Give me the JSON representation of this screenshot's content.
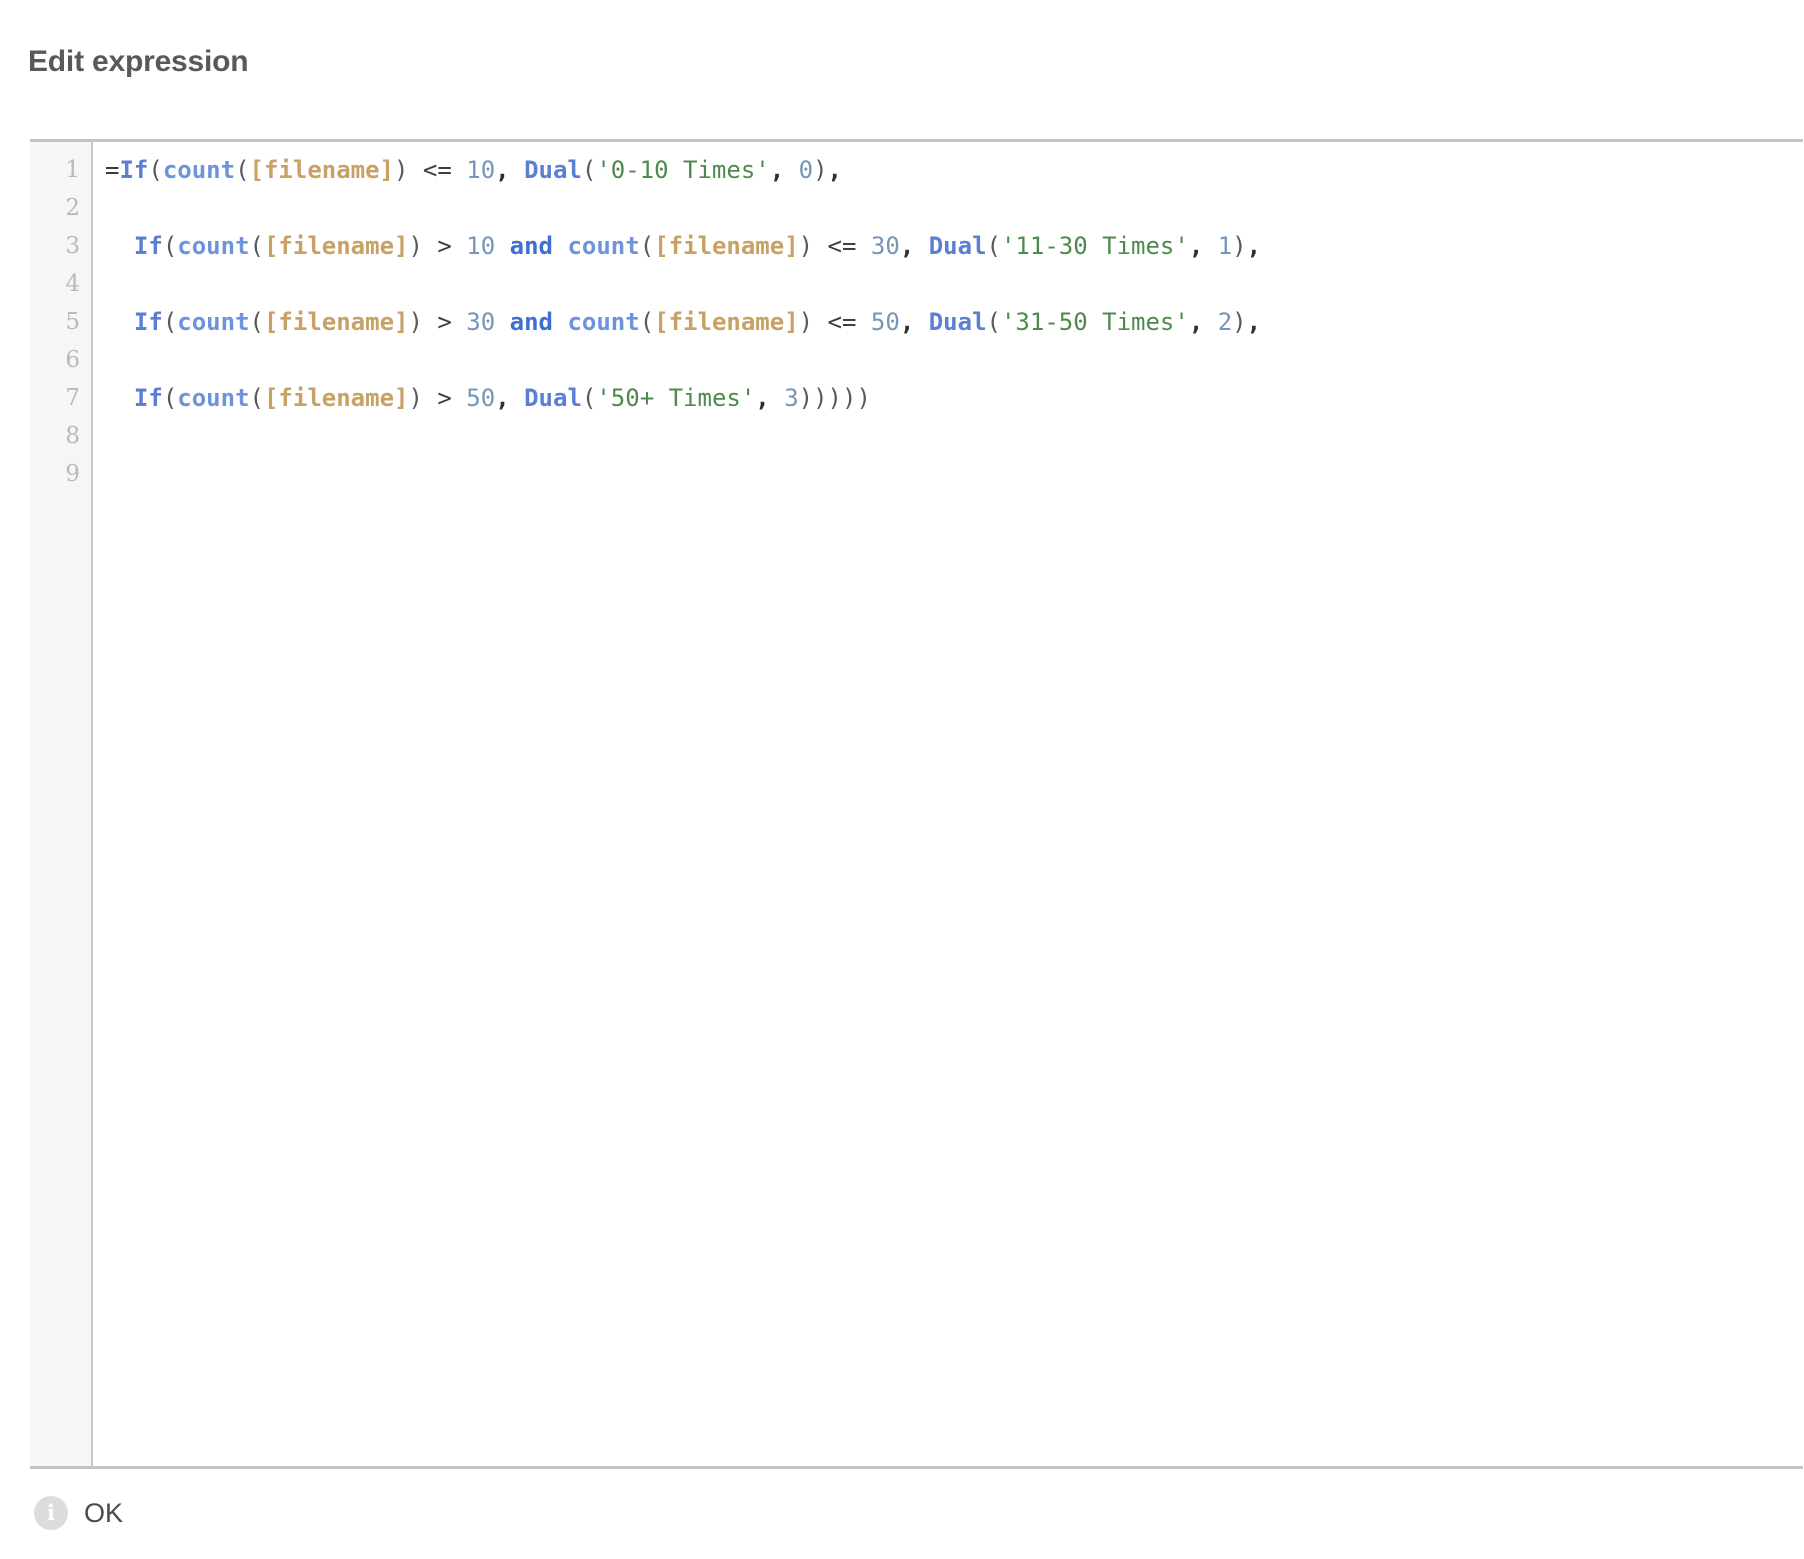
{
  "dialog": {
    "title": "Edit expression"
  },
  "editor": {
    "line_numbers": [
      "1",
      "2",
      "3",
      "4",
      "5",
      "6",
      "7",
      "8",
      "9"
    ],
    "lines": [
      {
        "number": "1",
        "text": "=If(count([filename]) <= 10, Dual('0-10 Times', 0),",
        "tokens": [
          {
            "t": "=",
            "c": "tok-plain"
          },
          {
            "t": "If",
            "c": "tok-func"
          },
          {
            "t": "(",
            "c": "tok-paren"
          },
          {
            "t": "count",
            "c": "tok-agg"
          },
          {
            "t": "(",
            "c": "tok-paren"
          },
          {
            "t": "[filename]",
            "c": "tok-field"
          },
          {
            "t": ")",
            "c": "tok-paren"
          },
          {
            "t": " <= ",
            "c": "tok-op"
          },
          {
            "t": "10",
            "c": "tok-num"
          },
          {
            "t": ",",
            "c": "tok-comma"
          },
          {
            "t": " ",
            "c": "tok-plain"
          },
          {
            "t": "Dual",
            "c": "tok-func"
          },
          {
            "t": "(",
            "c": "tok-paren"
          },
          {
            "t": "'0-10 Times'",
            "c": "tok-str"
          },
          {
            "t": ",",
            "c": "tok-comma"
          },
          {
            "t": " ",
            "c": "tok-plain"
          },
          {
            "t": "0",
            "c": "tok-num"
          },
          {
            "t": ")",
            "c": "tok-paren"
          },
          {
            "t": ",",
            "c": "tok-comma"
          }
        ]
      },
      {
        "number": "2",
        "text": "",
        "tokens": []
      },
      {
        "number": "3",
        "text": "  If(count([filename]) > 10 and count([filename]) <= 30, Dual('11-30 Times', 1),",
        "tokens": [
          {
            "t": "  ",
            "c": "tok-plain"
          },
          {
            "t": "If",
            "c": "tok-func"
          },
          {
            "t": "(",
            "c": "tok-paren"
          },
          {
            "t": "count",
            "c": "tok-agg"
          },
          {
            "t": "(",
            "c": "tok-paren"
          },
          {
            "t": "[filename]",
            "c": "tok-field"
          },
          {
            "t": ")",
            "c": "tok-paren"
          },
          {
            "t": " > ",
            "c": "tok-op"
          },
          {
            "t": "10",
            "c": "tok-num"
          },
          {
            "t": " ",
            "c": "tok-plain"
          },
          {
            "t": "and",
            "c": "tok-kw"
          },
          {
            "t": " ",
            "c": "tok-plain"
          },
          {
            "t": "count",
            "c": "tok-agg"
          },
          {
            "t": "(",
            "c": "tok-paren"
          },
          {
            "t": "[filename]",
            "c": "tok-field"
          },
          {
            "t": ")",
            "c": "tok-paren"
          },
          {
            "t": " <= ",
            "c": "tok-op"
          },
          {
            "t": "30",
            "c": "tok-num"
          },
          {
            "t": ",",
            "c": "tok-comma"
          },
          {
            "t": " ",
            "c": "tok-plain"
          },
          {
            "t": "Dual",
            "c": "tok-func"
          },
          {
            "t": "(",
            "c": "tok-paren"
          },
          {
            "t": "'11-30 Times'",
            "c": "tok-str"
          },
          {
            "t": ",",
            "c": "tok-comma"
          },
          {
            "t": " ",
            "c": "tok-plain"
          },
          {
            "t": "1",
            "c": "tok-num"
          },
          {
            "t": ")",
            "c": "tok-paren"
          },
          {
            "t": ",",
            "c": "tok-comma"
          }
        ]
      },
      {
        "number": "4",
        "text": "",
        "tokens": []
      },
      {
        "number": "5",
        "text": "  If(count([filename]) > 30 and count([filename]) <= 50, Dual('31-50 Times', 2),",
        "tokens": [
          {
            "t": "  ",
            "c": "tok-plain"
          },
          {
            "t": "If",
            "c": "tok-func"
          },
          {
            "t": "(",
            "c": "tok-paren"
          },
          {
            "t": "count",
            "c": "tok-agg"
          },
          {
            "t": "(",
            "c": "tok-paren"
          },
          {
            "t": "[filename]",
            "c": "tok-field"
          },
          {
            "t": ")",
            "c": "tok-paren"
          },
          {
            "t": " > ",
            "c": "tok-op"
          },
          {
            "t": "30",
            "c": "tok-num"
          },
          {
            "t": " ",
            "c": "tok-plain"
          },
          {
            "t": "and",
            "c": "tok-kw"
          },
          {
            "t": " ",
            "c": "tok-plain"
          },
          {
            "t": "count",
            "c": "tok-agg"
          },
          {
            "t": "(",
            "c": "tok-paren"
          },
          {
            "t": "[filename]",
            "c": "tok-field"
          },
          {
            "t": ")",
            "c": "tok-paren"
          },
          {
            "t": " <= ",
            "c": "tok-op"
          },
          {
            "t": "50",
            "c": "tok-num"
          },
          {
            "t": ",",
            "c": "tok-comma"
          },
          {
            "t": " ",
            "c": "tok-plain"
          },
          {
            "t": "Dual",
            "c": "tok-func"
          },
          {
            "t": "(",
            "c": "tok-paren"
          },
          {
            "t": "'31-50 Times'",
            "c": "tok-str"
          },
          {
            "t": ",",
            "c": "tok-comma"
          },
          {
            "t": " ",
            "c": "tok-plain"
          },
          {
            "t": "2",
            "c": "tok-num"
          },
          {
            "t": ")",
            "c": "tok-paren"
          },
          {
            "t": ",",
            "c": "tok-comma"
          }
        ]
      },
      {
        "number": "6",
        "text": "",
        "tokens": []
      },
      {
        "number": "7",
        "text": "  If(count([filename]) > 50, Dual('50+ Times', 3)))))",
        "tokens": [
          {
            "t": "  ",
            "c": "tok-plain"
          },
          {
            "t": "If",
            "c": "tok-func"
          },
          {
            "t": "(",
            "c": "tok-paren"
          },
          {
            "t": "count",
            "c": "tok-agg"
          },
          {
            "t": "(",
            "c": "tok-paren"
          },
          {
            "t": "[filename]",
            "c": "tok-field"
          },
          {
            "t": ")",
            "c": "tok-paren"
          },
          {
            "t": " > ",
            "c": "tok-op"
          },
          {
            "t": "50",
            "c": "tok-num"
          },
          {
            "t": ",",
            "c": "tok-comma"
          },
          {
            "t": " ",
            "c": "tok-plain"
          },
          {
            "t": "Dual",
            "c": "tok-func"
          },
          {
            "t": "(",
            "c": "tok-paren"
          },
          {
            "t": "'50+ Times'",
            "c": "tok-str"
          },
          {
            "t": ",",
            "c": "tok-comma"
          },
          {
            "t": " ",
            "c": "tok-plain"
          },
          {
            "t": "3",
            "c": "tok-num"
          },
          {
            "t": ")))))",
            "c": "tok-paren"
          }
        ]
      },
      {
        "number": "8",
        "text": "",
        "tokens": []
      },
      {
        "number": "9",
        "text": "",
        "tokens": []
      }
    ]
  },
  "footer": {
    "icon": "info-icon",
    "status_label": "OK"
  },
  "colors": {
    "title": "#595959",
    "gutter_bg": "#f6f6f6",
    "gutter_text": "#b9b9b9",
    "border": "#c3c3c3",
    "function": "#5b7fd4",
    "field": "#c8a165",
    "string": "#4e8a4e",
    "number": "#7596b8",
    "keyword": "#3f6fd0",
    "info_icon_bg": "#dcdcdc"
  }
}
